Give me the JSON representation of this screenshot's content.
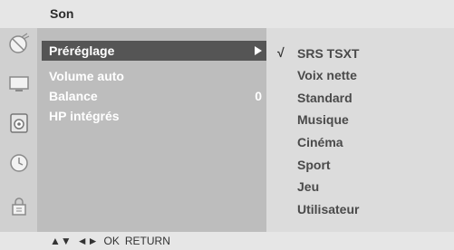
{
  "window": {
    "title": "Son"
  },
  "sidebar": {
    "items": [
      {
        "icon": "satellite-icon",
        "selected": false
      },
      {
        "icon": "monitor-icon",
        "selected": false
      },
      {
        "icon": "speaker-icon",
        "selected": true
      },
      {
        "icon": "clock-icon",
        "selected": false
      },
      {
        "icon": "lock-icon",
        "selected": false
      }
    ]
  },
  "menu": {
    "items": [
      {
        "label": "Préréglage",
        "selected": true,
        "has_submenu": true
      },
      {
        "label": "Volume auto"
      },
      {
        "label": "Balance",
        "value": "0"
      },
      {
        "label": "HP intégrés"
      }
    ]
  },
  "submenu": {
    "check_mark": "√",
    "items": [
      {
        "label": "SRS TSXT",
        "checked": true
      },
      {
        "label": "Voix nette"
      },
      {
        "label": "Standard"
      },
      {
        "label": "Musique"
      },
      {
        "label": "Cinéma"
      },
      {
        "label": "Sport"
      },
      {
        "label": "Jeu"
      },
      {
        "label": "Utilisateur"
      }
    ]
  },
  "footer": {
    "nav_updown": "▲▼",
    "nav_leftright": "◄►",
    "ok_label": "OK",
    "return_label": "RETURN"
  },
  "colors": {
    "menu_bg": "#bdbdbd",
    "selected_bg": "#555555",
    "submenu_bg": "#dcdcdc"
  }
}
